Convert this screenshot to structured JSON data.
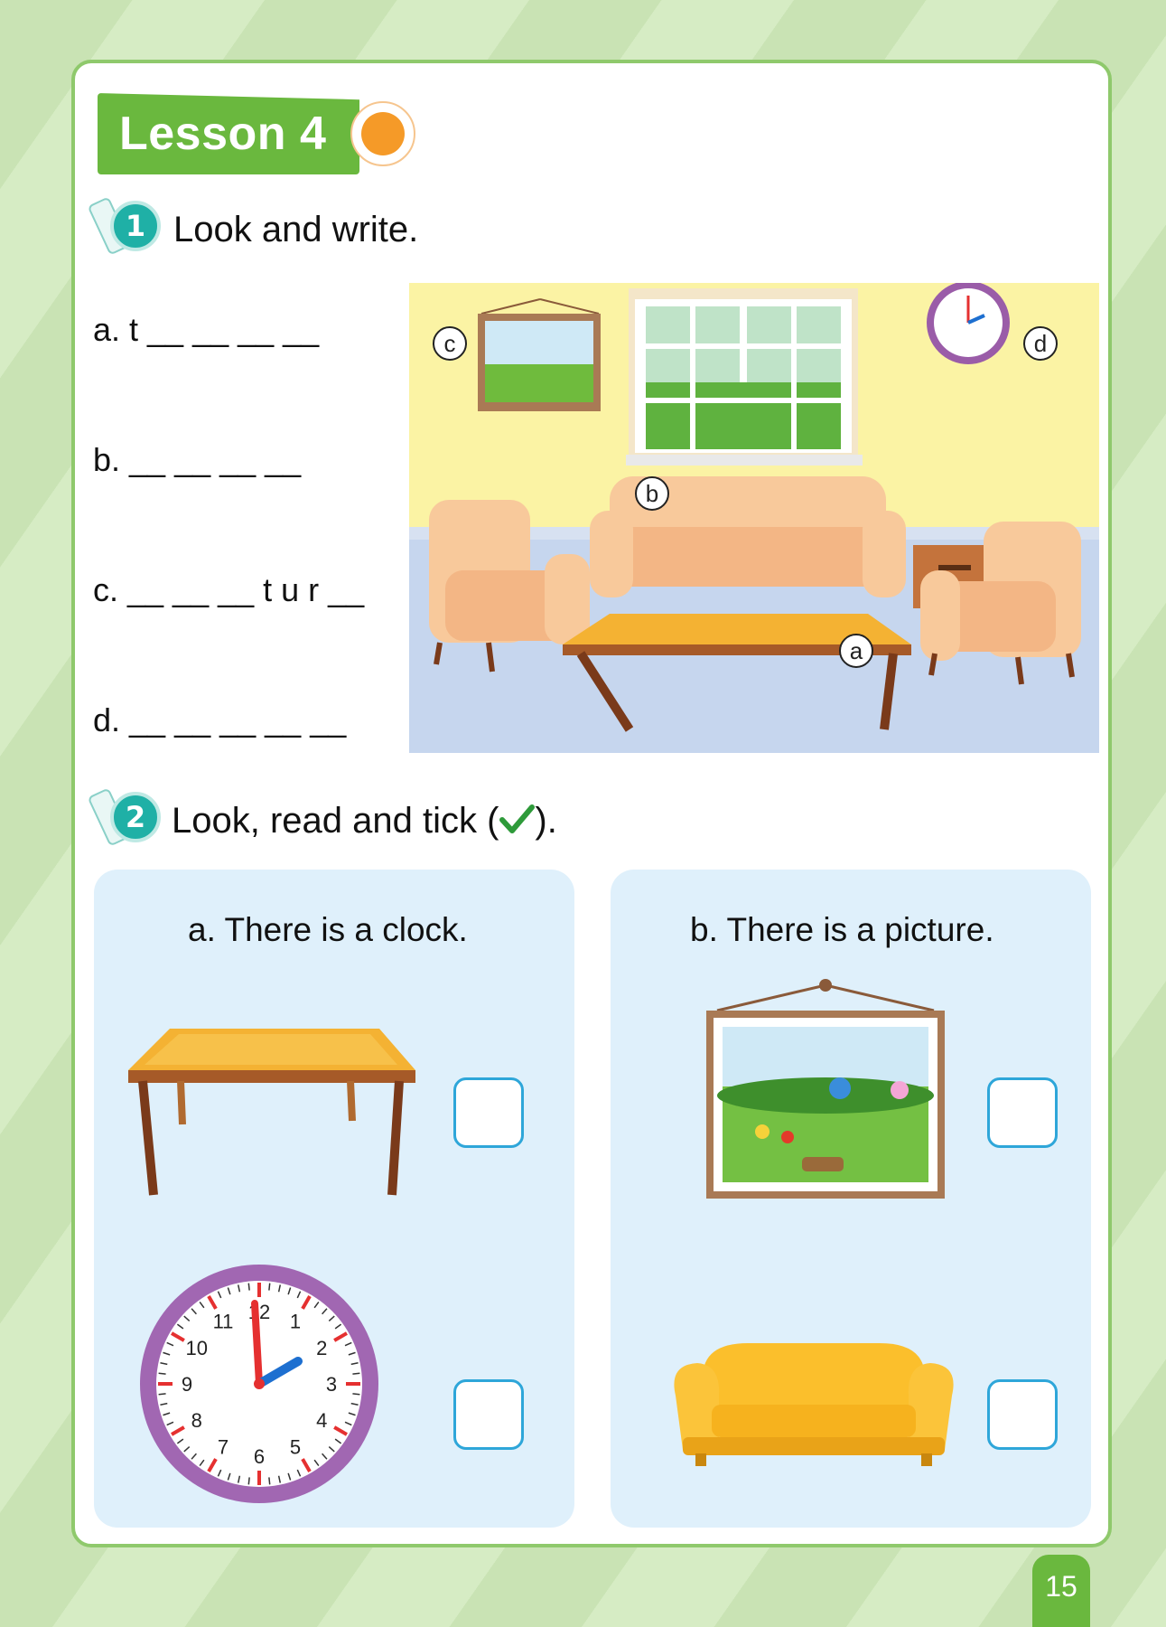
{
  "lesson": {
    "title": "Lesson 4"
  },
  "exercise1": {
    "number": "1",
    "title": "Look and write.",
    "items": [
      {
        "label": "a. t __ __ __ __"
      },
      {
        "label": "b. __ __ __ __"
      },
      {
        "label": "c. __ __ __ t u r __"
      },
      {
        "label": "d. __ __ __ __ __"
      }
    ],
    "scene_labels": {
      "a": "a",
      "b": "b",
      "c": "c",
      "d": "d"
    }
  },
  "exercise2": {
    "number": "2",
    "title_before": "Look, read and tick (",
    "title_after": ").",
    "panels": [
      {
        "title": "a. There is a clock."
      },
      {
        "title": "b. There is a picture."
      }
    ],
    "clock_numbers": [
      "12",
      "1",
      "2",
      "3",
      "4",
      "5",
      "6",
      "7",
      "8",
      "9",
      "10",
      "11"
    ]
  },
  "page": {
    "number": "15"
  },
  "colors": {
    "accent_green": "#6ab83e",
    "teal": "#1fb0a6",
    "panel_blue": "#dff0fb",
    "tick_border": "#2ea6d9"
  }
}
